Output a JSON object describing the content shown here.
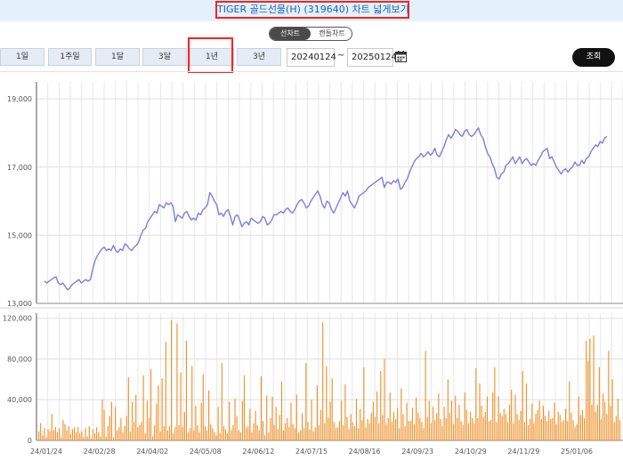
{
  "header": {
    "title": "TIGER 골드선물(H) (319640) 차트 넓게보기"
  },
  "chart_toggle": {
    "line_label": "선차트",
    "candle_label": "캔들차트",
    "selected": "선차트"
  },
  "periods": [
    "1일",
    "1주일",
    "1달",
    "3달",
    "1년",
    "3년"
  ],
  "selected_period": "1년",
  "date_range": {
    "start": "20240124",
    "separator": "~",
    "end": "20250124"
  },
  "search_label": "조회",
  "colors": {
    "price_line": "#7b7fd9",
    "volume_bar": "#f0922b",
    "highlight": "#ff2020",
    "title_text": "#1565c0"
  },
  "icons": {
    "calendar": "calendar-icon"
  },
  "chart_data": [
    {
      "type": "line",
      "series": [
        {
          "values": [
            13650,
            13600,
            13650,
            13700,
            13750,
            13780,
            13600,
            13550,
            13600,
            13500,
            13400,
            13450,
            13550,
            13600,
            13650,
            13700,
            13600,
            13650,
            13700,
            13650,
            13700,
            14000,
            14250,
            14400,
            14500,
            14600,
            14650,
            14550,
            14600,
            14550,
            14700,
            14550,
            14500,
            14600,
            14550,
            14750,
            14700,
            14600,
            14550,
            14650,
            14700,
            14800,
            15000,
            15150,
            15200,
            15400,
            15500,
            15600,
            15700,
            15650,
            15900,
            15850,
            15800,
            15950,
            15900,
            15950,
            15850,
            15400,
            15600,
            15550,
            15500,
            15650,
            15700,
            15550,
            15450,
            15500,
            15450,
            15650,
            15600,
            15750,
            15800,
            15900,
            16250,
            16150,
            16000,
            15900,
            15600,
            15650,
            15550,
            15700,
            15750,
            15550,
            15300,
            15550,
            15600,
            15450,
            15250,
            15350,
            15400,
            15300,
            15500,
            15450,
            15400,
            15350,
            15400,
            15550,
            15500,
            15300,
            15350,
            15450,
            15600,
            15600,
            15650,
            15700,
            15650,
            15750,
            15800,
            15700,
            15650,
            15750,
            15900,
            16000,
            16050,
            15950,
            15800,
            15850,
            16000,
            16100,
            16200,
            16300,
            16150,
            15900,
            15800,
            16000,
            15950,
            15750,
            15650,
            15800,
            15950,
            16100,
            16250,
            16150,
            16300,
            16000,
            15900,
            15800,
            15950,
            16150,
            16200,
            16250,
            16300,
            16400,
            16450,
            16500,
            16550,
            16600,
            16650,
            16700,
            16400,
            16550,
            16550,
            16500,
            16600,
            16550,
            16650,
            16350,
            16400,
            16550,
            16650,
            16850,
            17000,
            17150,
            17250,
            17300,
            17400,
            17300,
            17350,
            17450,
            17350,
            17400,
            17550,
            17350,
            17300,
            17450,
            17600,
            17800,
            17950,
            17850,
            17950,
            18100,
            18050,
            17950,
            17900,
            18050,
            18100,
            17950,
            17900,
            17950,
            18050,
            18150,
            17950,
            17850,
            17600,
            17400,
            17300,
            17100,
            16950,
            16700,
            16650,
            16800,
            16850,
            17050,
            17100,
            17200,
            17300,
            17100,
            17200,
            17300,
            17100,
            17200,
            17250,
            17150,
            17050,
            17100,
            17050,
            17200,
            17300,
            17450,
            17500,
            17550,
            17250,
            17300,
            17150,
            17000,
            16900,
            16800,
            16900,
            16950,
            16850,
            16950,
            17000,
            17150,
            17050,
            17050,
            17200,
            17100,
            17250,
            17300,
            17450,
            17550,
            17650,
            17600,
            17750,
            17700,
            17850,
            17900
          ]
        }
      ],
      "x_tick_labels": [
        "24/01/24",
        "24/02/28",
        "24/04/02",
        "24/05/08",
        "24/06/12",
        "24/07/15",
        "24/08/16",
        "24/09/23",
        "24/10/29",
        "24/11/29",
        "25/01/06"
      ],
      "y_tick_labels": [
        "13,000",
        "15,000",
        "17,000",
        "19,000"
      ],
      "ylim": [
        13000,
        19500
      ],
      "grid": true
    },
    {
      "type": "bar",
      "series": [
        {
          "values": [
            9000,
            17000,
            5000,
            12000,
            3000,
            11000,
            9000,
            26000,
            10000,
            13000,
            8000,
            12000,
            3000,
            20000,
            16000,
            10000,
            14000,
            6000,
            11000,
            13000,
            8000,
            13000,
            7000,
            9000,
            3000,
            12000,
            4000,
            14000,
            2000,
            11000,
            7000,
            13000,
            8000,
            4000,
            40000,
            30000,
            4000,
            14000,
            24000,
            38000,
            3000,
            33000,
            10000,
            13000,
            22000,
            8000,
            14000,
            24000,
            62000,
            9000,
            38000,
            18000,
            45000,
            13000,
            15000,
            18000,
            64000,
            7000,
            39000,
            22000,
            70000,
            4000,
            15000,
            36000,
            54000,
            9000,
            61000,
            14000,
            97000,
            10000,
            14000,
            118000,
            7000,
            13000,
            115000,
            15000,
            67000,
            13000,
            28000,
            98000,
            8000,
            12000,
            73000,
            10000,
            34000,
            15000,
            8000,
            37000,
            65000,
            14000,
            10000,
            49000,
            16000,
            12000,
            8000,
            5000,
            33000,
            7000,
            76000,
            14000,
            11000,
            7000,
            38000,
            10000,
            15000,
            41000,
            24000,
            10000,
            8000,
            39000,
            64000,
            12000,
            14000,
            31000,
            8000,
            17000,
            29000,
            15000,
            10000,
            63000,
            19000,
            5000,
            44000,
            8000,
            22000,
            43000,
            15000,
            33000,
            11000,
            25000,
            58000,
            10000,
            17000,
            22000,
            13000,
            37000,
            16000,
            12000,
            45000,
            8000,
            10000,
            27000,
            12000,
            76000,
            18000,
            11000,
            40000,
            9000,
            13000,
            54000,
            15000,
            30000,
            116000,
            17000,
            73000,
            22000,
            38000,
            61000,
            18000,
            12000,
            13000,
            19000,
            39000,
            15000,
            55000,
            23000,
            11000,
            26000,
            18000,
            14000,
            41000,
            12000,
            31000,
            20000,
            72000,
            13000,
            21000,
            17000,
            27000,
            38000,
            23000,
            48000,
            17000,
            68000,
            25000,
            80000,
            16000,
            22000,
            47000,
            18000,
            28000,
            21000,
            32000,
            12000,
            51000,
            26000,
            14000,
            37000,
            19000,
            19000,
            32000,
            16000,
            42000,
            27000,
            22000,
            18000,
            12000,
            88000,
            23000,
            39000,
            17000,
            33000,
            20000,
            27000,
            46000,
            21000,
            14000,
            33000,
            22000,
            60000,
            27000,
            39000,
            16000,
            44000,
            22000,
            35000,
            19000,
            15000,
            47000,
            30000,
            17000,
            28000,
            22000,
            17000,
            71000,
            22000,
            56000,
            34000,
            23000,
            28000,
            43000,
            19000,
            20000,
            47000,
            72000,
            18000,
            43000,
            27000,
            24000,
            31000,
            26000,
            18000,
            35000,
            50000,
            17000,
            45000,
            26000,
            20000,
            29000,
            68000,
            18000,
            56000,
            15000,
            21000,
            36000,
            17000,
            26000,
            30000,
            39000,
            21000,
            34000,
            24000,
            19000,
            29000,
            21000,
            22000,
            37000,
            16000,
            28000,
            25000,
            18000,
            20000,
            31000,
            19000,
            58000,
            27000,
            20000,
            13000,
            16000,
            43000,
            25000,
            30000,
            22000,
            98000,
            78000,
            100000,
            35000,
            103000,
            28000,
            35000,
            72000,
            21000,
            46000,
            38000,
            26000,
            88000,
            34000,
            60000,
            18000,
            24000,
            41000,
            20000
          ]
        }
      ],
      "y_tick_labels": [
        "0",
        "40,000",
        "80,000",
        "120,000"
      ],
      "ylim": [
        0,
        125000
      ],
      "grid": true
    }
  ]
}
